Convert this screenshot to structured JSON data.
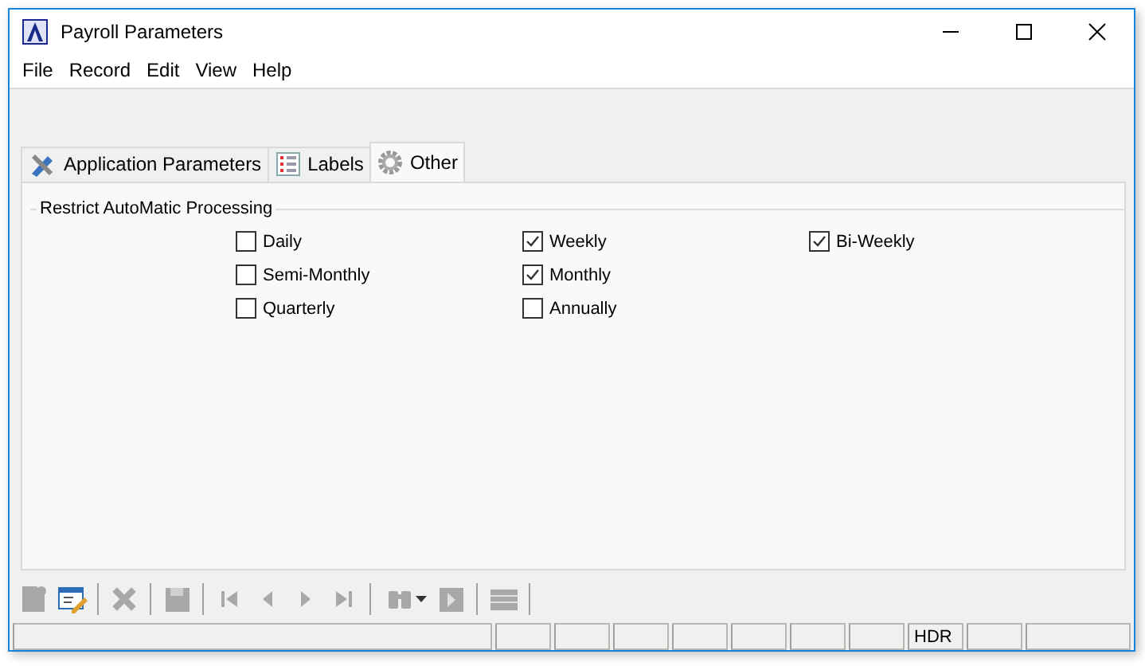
{
  "window": {
    "title": "Payroll Parameters"
  },
  "menu": [
    "File",
    "Record",
    "Edit",
    "View",
    "Help"
  ],
  "tabs": [
    {
      "label": "Application Parameters",
      "kind": "tools",
      "selected": false
    },
    {
      "label": "Labels",
      "kind": "list",
      "selected": false
    },
    {
      "label": "Other",
      "kind": "gear",
      "selected": true
    }
  ],
  "group": {
    "title": "Restrict AutoMatic Processing",
    "rows": [
      [
        {
          "label": "Daily",
          "checked": false
        },
        {
          "label": "Weekly",
          "checked": true
        },
        {
          "label": "Bi-Weekly",
          "checked": true
        }
      ],
      [
        {
          "label": "Semi-Monthly",
          "checked": false
        },
        {
          "label": "Monthly",
          "checked": true
        }
      ],
      [
        {
          "label": "Quarterly",
          "checked": false
        },
        {
          "label": "Annually",
          "checked": false
        }
      ]
    ]
  },
  "toolbar": [
    {
      "kind": "new",
      "disabled": true
    },
    {
      "kind": "edit",
      "disabled": false
    },
    {
      "kind": "sep"
    },
    {
      "kind": "delete",
      "disabled": true
    },
    {
      "kind": "sep"
    },
    {
      "kind": "save",
      "disabled": true
    },
    {
      "kind": "sep"
    },
    {
      "kind": "first",
      "disabled": true
    },
    {
      "kind": "prev",
      "disabled": true
    },
    {
      "kind": "next",
      "disabled": true
    },
    {
      "kind": "last",
      "disabled": true
    },
    {
      "kind": "sep"
    },
    {
      "kind": "find",
      "disabled": true
    },
    {
      "kind": "report",
      "disabled": true
    },
    {
      "kind": "sep"
    },
    {
      "kind": "list",
      "disabled": true
    },
    {
      "kind": "sep"
    }
  ],
  "status_bar": {
    "cells": [
      {
        "kind": "wide"
      },
      {
        "kind": "cell"
      },
      {
        "kind": "cell"
      },
      {
        "kind": "cell"
      },
      {
        "kind": "cell"
      },
      {
        "kind": "cell"
      },
      {
        "kind": "cell"
      },
      {
        "kind": "cell"
      },
      {
        "kind": "text",
        "text": "HDR"
      },
      {
        "kind": "cell"
      },
      {
        "kind": "fill"
      }
    ]
  }
}
